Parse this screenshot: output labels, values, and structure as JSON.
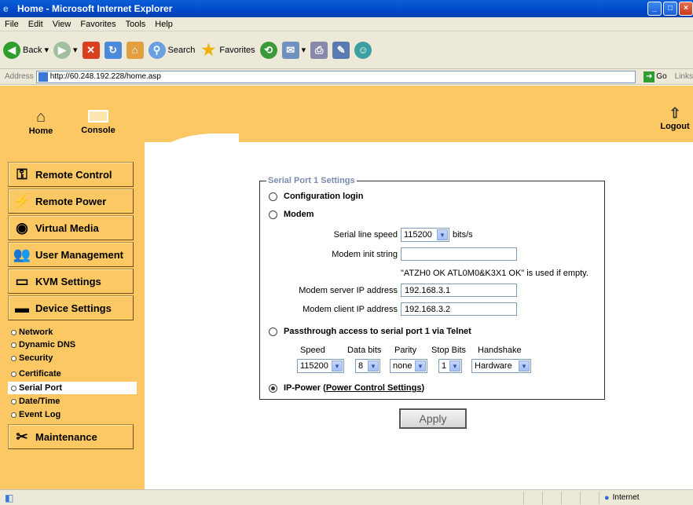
{
  "window": {
    "title": "Home - Microsoft Internet Explorer"
  },
  "menubar": [
    "File",
    "Edit",
    "View",
    "Favorites",
    "Tools",
    "Help"
  ],
  "toolbar": {
    "back": "Back",
    "search": "Search",
    "favorites": "Favorites"
  },
  "address": {
    "label": "Address",
    "url": "http://60.248.192.228/home.asp",
    "go": "Go",
    "links": "Links"
  },
  "topnav": {
    "home": "Home",
    "console": "Console",
    "logout": "Logout"
  },
  "sidebar": {
    "menus": [
      "Remote Control",
      "Remote Power",
      "Virtual Media",
      "User Management",
      "KVM Settings",
      "Device Settings",
      "Maintenance"
    ],
    "submenu": [
      "Network",
      "Dynamic DNS",
      "Security",
      "Certificate",
      "Serial Port",
      "Date/Time",
      "Event Log"
    ]
  },
  "form": {
    "legend": "Serial Port 1 Settings",
    "config_login": "Configuration login",
    "modem": "Modem",
    "serial_speed_label": "Serial line speed",
    "serial_speed_value": "115200",
    "serial_speed_unit": "bits/s",
    "modem_init_label": "Modem init string",
    "modem_init_value": "",
    "modem_init_note": "\"ATZH0 OK ATL0M0&K3X1 OK\" is used if empty.",
    "server_ip_label": "Modem server IP address",
    "server_ip_value": "192.168.3.1",
    "client_ip_label": "Modem client IP address",
    "client_ip_value": "192.168.3.2",
    "passthrough": "Passthrough access to serial port 1 via Telnet",
    "headers": [
      "Speed",
      "Data bits",
      "Parity",
      "Stop Bits",
      "Handshake"
    ],
    "values": [
      "115200",
      "8",
      "none",
      "1",
      "Hardware"
    ],
    "ippower": "IP-Power",
    "ippower_link": "Power Control Settings",
    "apply": "Apply"
  },
  "status": {
    "zone": "Internet"
  }
}
